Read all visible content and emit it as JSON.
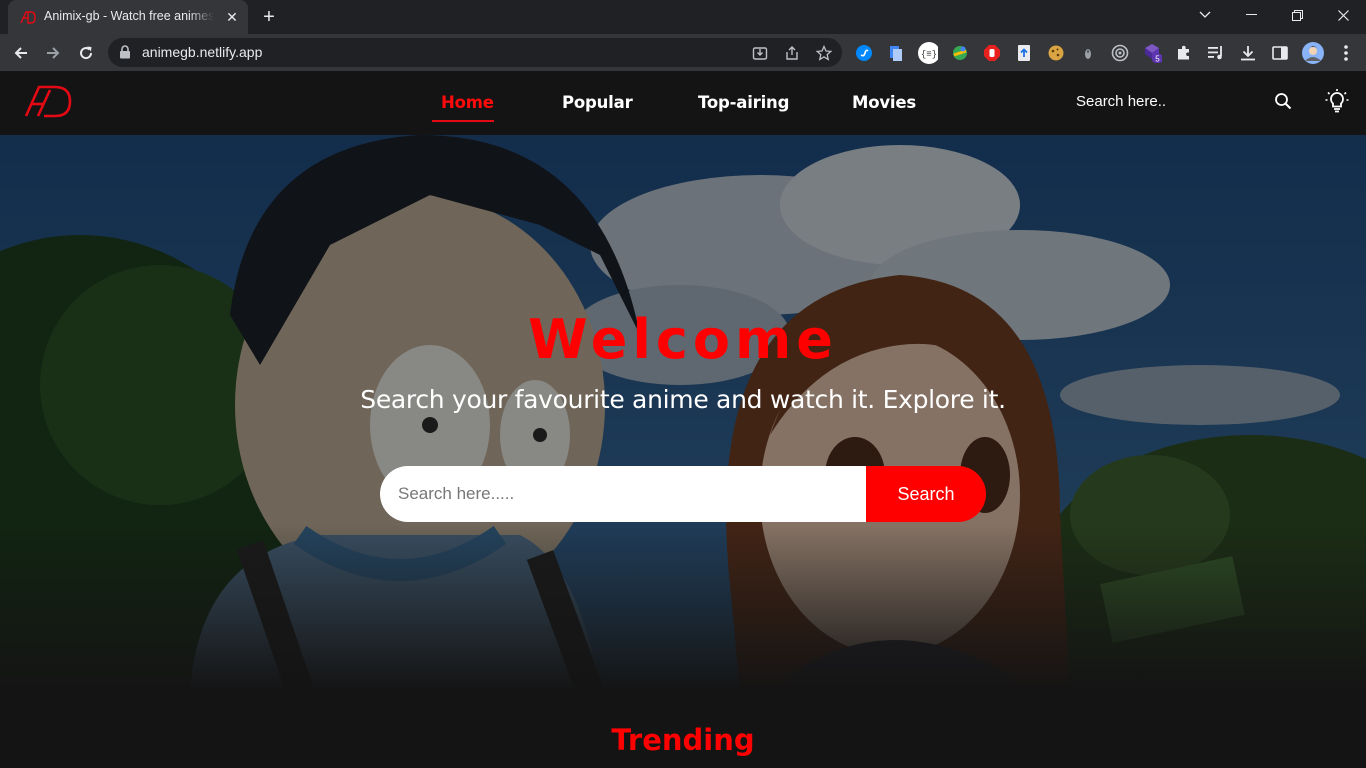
{
  "browser": {
    "tab_title": "Animix-gb - Watch free animes, no ads",
    "url": "animegb.netlify.app",
    "extension_badge": "5"
  },
  "nav": {
    "links": [
      "Home",
      "Popular",
      "Top-airing",
      "Movies"
    ],
    "active": "Home",
    "search_placeholder": "Search here.."
  },
  "hero": {
    "title": "Welcome",
    "subtitle": "Search your favourite anime and watch it. Explore it.",
    "search_placeholder": "Search here.....",
    "search_button": "Search"
  },
  "section": {
    "title": "Trending"
  },
  "colors": {
    "accent": "#ff0000",
    "nav_bg": "#141414",
    "chrome_tabstrip": "#202124",
    "chrome_toolbar": "#35363a"
  }
}
